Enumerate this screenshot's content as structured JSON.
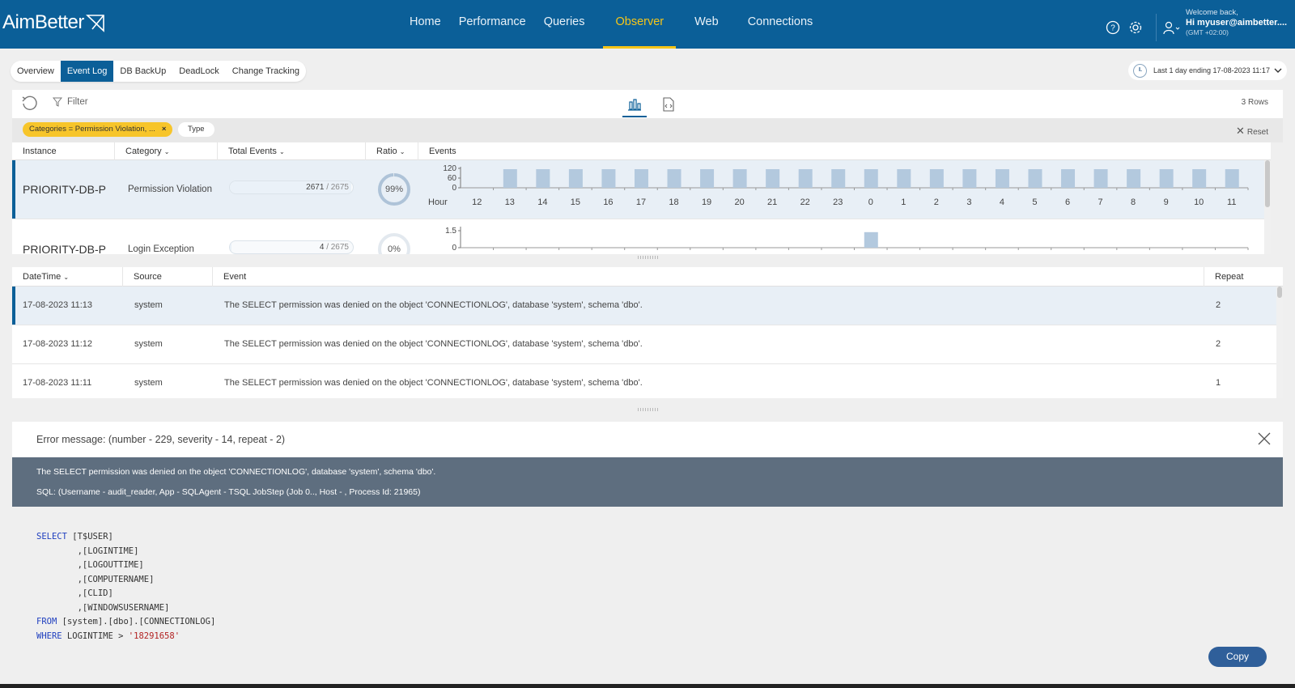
{
  "brand": {
    "name": "AimBetter"
  },
  "nav": {
    "items": [
      {
        "label": "Home",
        "active": false
      },
      {
        "label": "Performance",
        "active": false
      },
      {
        "label": "Queries",
        "active": false
      },
      {
        "label": "Observer",
        "active": true
      },
      {
        "label": "Web",
        "active": false
      },
      {
        "label": "Connections",
        "active": false
      }
    ]
  },
  "user": {
    "welcome": "Welcome back,",
    "greeting": "Hi myuser@aimbetter....",
    "timezone": "(GMT +02:00)"
  },
  "subtabs": [
    {
      "label": "Overview",
      "active": false
    },
    {
      "label": "Event Log",
      "active": true
    },
    {
      "label": "DB BackUp",
      "active": false
    },
    {
      "label": "DeadLock",
      "active": false
    },
    {
      "label": "Change Tracking",
      "active": false
    }
  ],
  "time_range": "Last 1 day ending  17-08-2023 11:17",
  "toolbar": {
    "filter_label": "Filter",
    "rows_label": "3 Rows",
    "reset_label": "Reset"
  },
  "filters": {
    "active_chip": "Categories = Permission Violation, ...",
    "type_chip": "Type"
  },
  "instance_table": {
    "columns": [
      "Instance",
      "Category",
      "Total Events",
      "Ratio",
      "Events"
    ],
    "hour_label": "Hour",
    "hours": [
      "12",
      "13",
      "14",
      "15",
      "16",
      "17",
      "18",
      "19",
      "20",
      "21",
      "22",
      "23",
      "0",
      "1",
      "2",
      "3",
      "4",
      "5",
      "6",
      "7",
      "8",
      "9",
      "10",
      "11"
    ],
    "rows": [
      {
        "instance": "PRIORITY-DB-P",
        "category": "Permission Violation",
        "count": "2671",
        "total": "/ 2675",
        "ratio": "99%",
        "ratio_value": 0.99,
        "y_ticks": [
          "120",
          "60",
          "0"
        ],
        "y_max": 120,
        "hourly_events": [
          0,
          115,
          115,
          115,
          115,
          115,
          115,
          115,
          115,
          115,
          115,
          115,
          115,
          115,
          115,
          115,
          115,
          115,
          115,
          115,
          115,
          115,
          115,
          115
        ]
      },
      {
        "instance": "PRIORITY-DB-P",
        "category": "Login Exception",
        "count": "4",
        "total": "/ 2675",
        "ratio": "0%",
        "ratio_value": 0.0,
        "y_ticks": [
          "1.5",
          "0"
        ],
        "y_max": 1.5,
        "hourly_events": [
          0,
          0,
          0,
          0,
          0,
          0,
          0,
          0,
          0,
          0,
          0,
          0,
          1.2,
          0,
          0,
          0,
          0,
          0,
          0,
          0,
          0,
          0,
          0,
          0
        ]
      }
    ]
  },
  "event_table": {
    "columns": [
      "DateTime",
      "Source",
      "Event",
      "Repeat"
    ],
    "rows": [
      {
        "datetime": "17-08-2023 11:13",
        "source": "system",
        "event": "The SELECT permission was denied on the object 'CONNECTIONLOG', database 'system', schema 'dbo'.",
        "repeat": "2"
      },
      {
        "datetime": "17-08-2023 11:12",
        "source": "system",
        "event": "The SELECT permission was denied on the object 'CONNECTIONLOG', database 'system', schema 'dbo'.",
        "repeat": "2"
      },
      {
        "datetime": "17-08-2023 11:11",
        "source": "system",
        "event": "The SELECT permission was denied on the object 'CONNECTIONLOG', database 'system', schema 'dbo'.",
        "repeat": "1"
      }
    ]
  },
  "detail": {
    "title": "Error message: (number - 229, severity - 14, repeat - 2)",
    "message": "The SELECT permission was denied on the object 'CONNECTIONLOG', database 'system', schema 'dbo'.",
    "sql_info": "SQL: (Username - audit_reader, App - SQLAgent - TSQL JobStep (Job 0.., Host - , Process Id: 21965)",
    "code": {
      "kw_select": "SELECT",
      "col1": " [T$USER]",
      "col2": "        ,[LOGINTIME]",
      "col3": "        ,[LOGOUTTIME]",
      "col4": "        ,[COMPUTERNAME]",
      "col5": "        ,[CLID]",
      "col6": "        ,[WINDOWSUSERNAME]",
      "kw_from": "FROM",
      "from_obj": " [system].[dbo].[CONNECTIONLOG]",
      "kw_where": "WHERE",
      "where_cond": " LOGINTIME > ",
      "where_val": "'18291658'"
    },
    "copy_label": "Copy"
  },
  "colors": {
    "brand_blue": "#0b5f98",
    "accent_yellow": "#f5c518",
    "bar_fill": "#b3c9de",
    "message_bg": "#5e6e7f"
  }
}
